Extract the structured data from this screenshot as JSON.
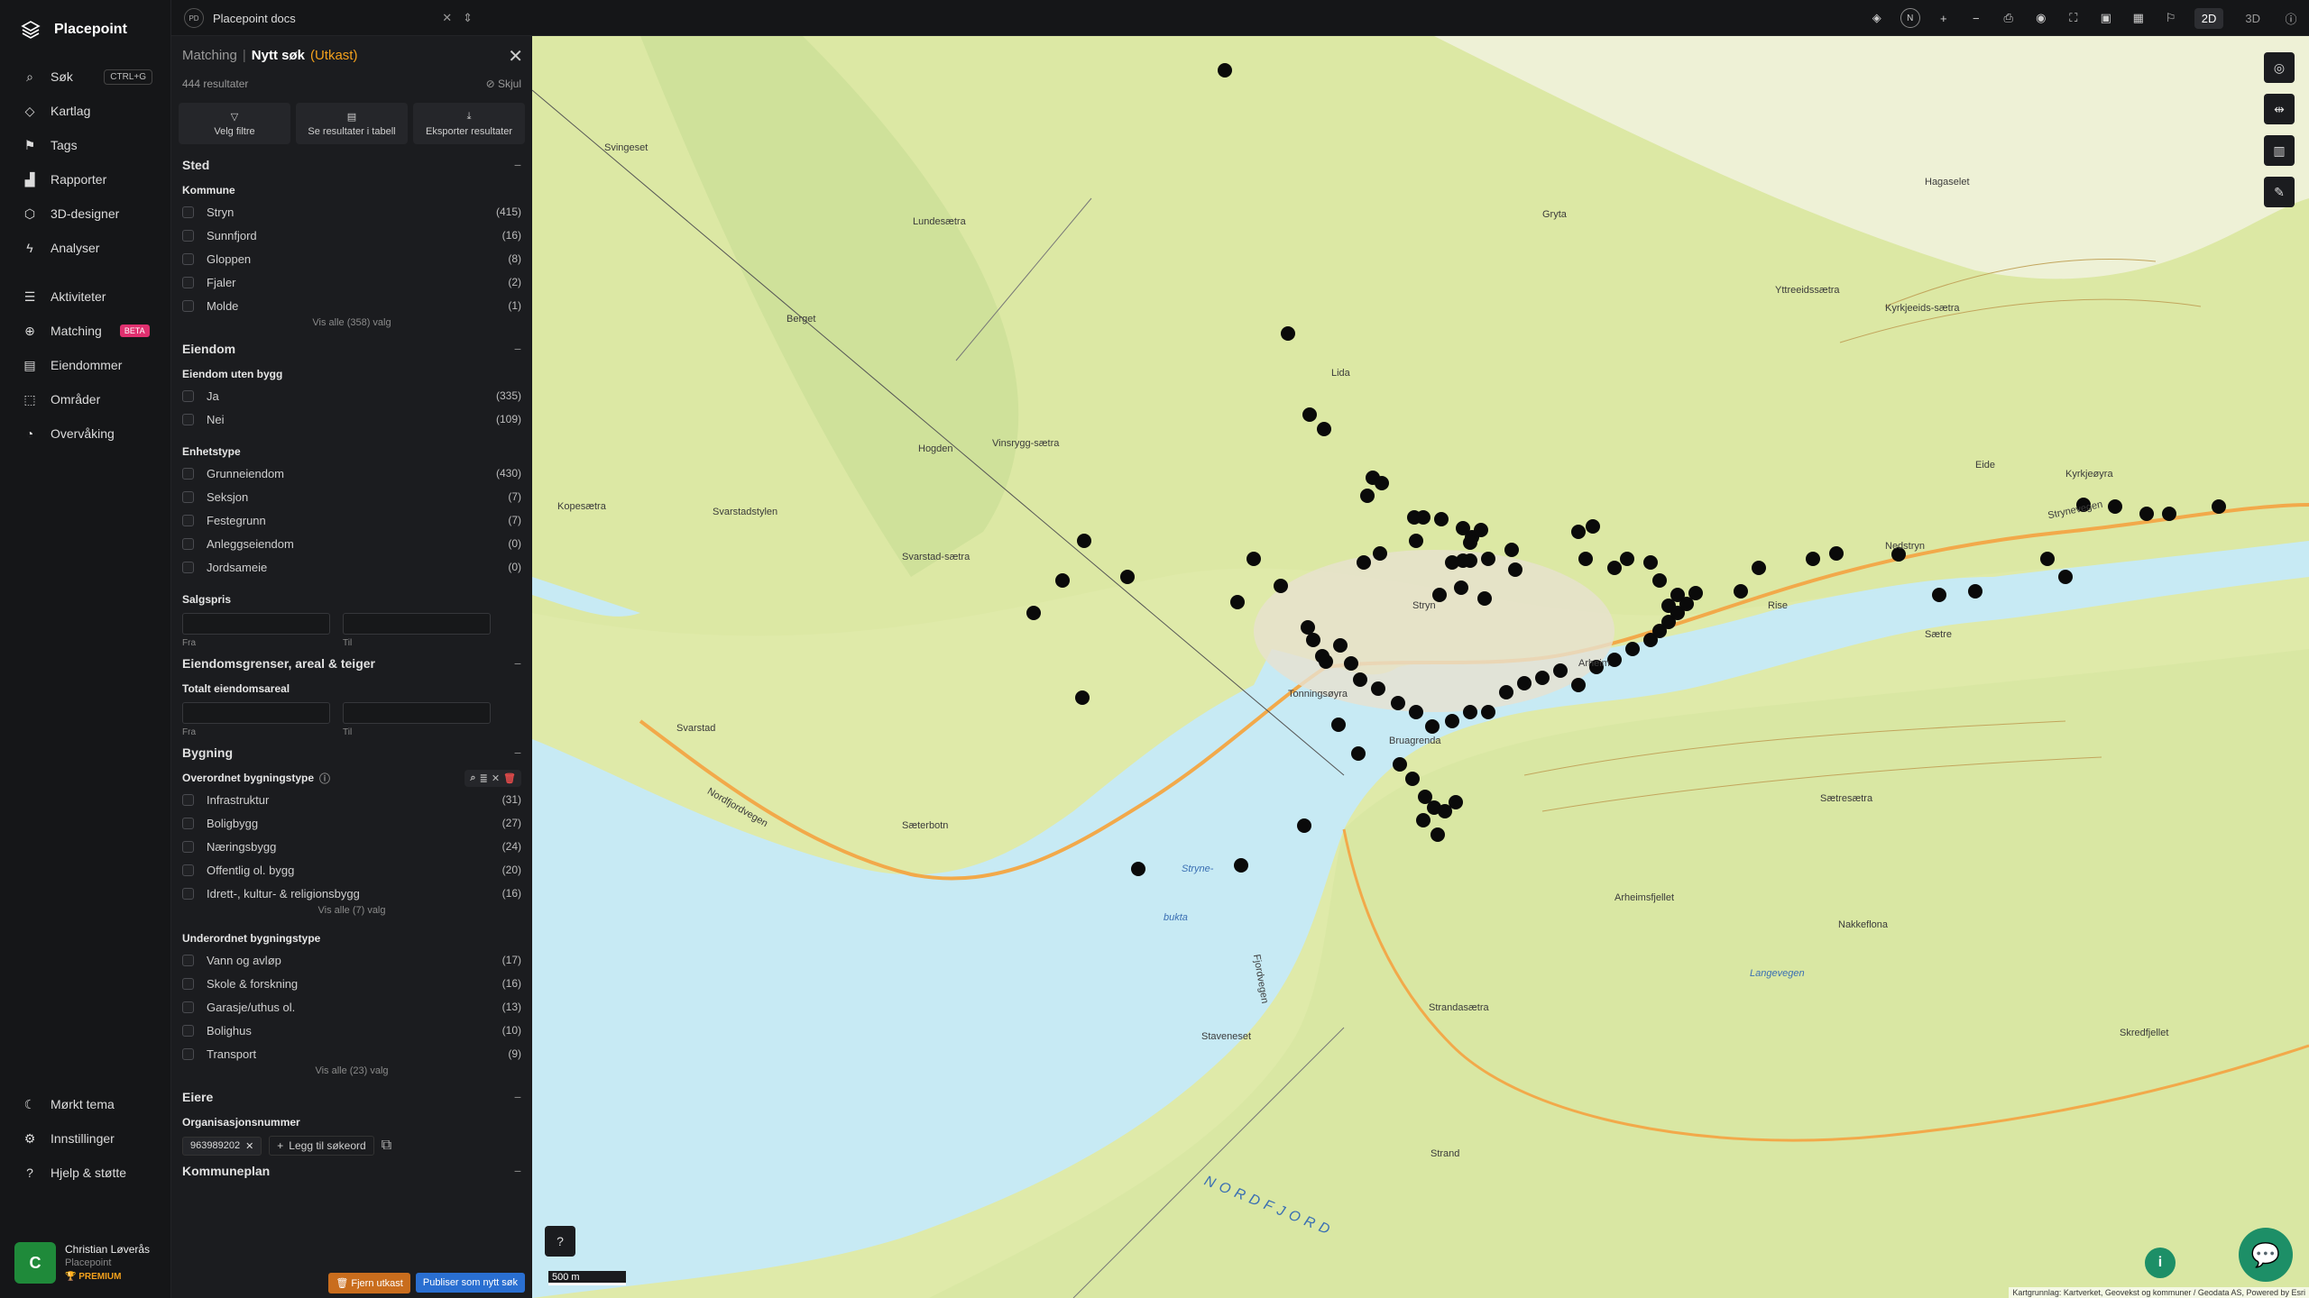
{
  "app": {
    "name": "Placepoint"
  },
  "nav": {
    "items": [
      {
        "label": "Søk",
        "kbd": "CTRL+G",
        "icon": "search-icon"
      },
      {
        "label": "Kartlag",
        "icon": "layers-icon"
      },
      {
        "label": "Tags",
        "icon": "bookmark-icon"
      },
      {
        "label": "Rapporter",
        "icon": "chart-icon"
      },
      {
        "label": "3D-designer",
        "icon": "cube-icon"
      },
      {
        "label": "Analyser",
        "icon": "bolt-icon"
      }
    ],
    "items2": [
      {
        "label": "Aktiviteter",
        "icon": "activity-icon"
      },
      {
        "label": "Matching",
        "badge": "BETA",
        "icon": "match-icon"
      },
      {
        "label": "Eiendommer",
        "icon": "building-icon"
      },
      {
        "label": "Områder",
        "icon": "area-icon"
      },
      {
        "label": "Overvåking",
        "icon": "monitor-icon"
      }
    ],
    "bottom": [
      {
        "label": "Mørkt tema",
        "icon": "moon-icon"
      },
      {
        "label": "Innstillinger",
        "icon": "gear-icon"
      },
      {
        "label": "Hjelp & støtte",
        "icon": "help-icon"
      }
    ],
    "user": {
      "initial": "C",
      "name": "Christian Løverås",
      "org": "Placepoint",
      "plan": "PREMIUM"
    }
  },
  "topbar": {
    "doc_badge": "PD",
    "doc_title": "Placepoint docs",
    "view_2d": "2D",
    "view_3d": "3D"
  },
  "panel": {
    "crumb": "Matching",
    "sep": "|",
    "title": "Nytt søk",
    "draft": "(Utkast)",
    "results": "444 resultater",
    "hide": "Skjul",
    "actions": [
      "Velg filtre",
      "Se resultater i tabell",
      "Eksporter resultater"
    ],
    "sted": {
      "title": "Sted",
      "group": "Kommune",
      "rows": [
        {
          "label": "Stryn",
          "count": "(415)"
        },
        {
          "label": "Sunnfjord",
          "count": "(16)"
        },
        {
          "label": "Gloppen",
          "count": "(8)"
        },
        {
          "label": "Fjaler",
          "count": "(2)"
        },
        {
          "label": "Molde",
          "count": "(1)"
        }
      ],
      "show_all": "Vis alle (358) valg"
    },
    "eiendom": {
      "title": "Eiendom",
      "group1": "Eiendom uten bygg",
      "rows1": [
        {
          "label": "Ja",
          "count": "(335)"
        },
        {
          "label": "Nei",
          "count": "(109)"
        }
      ],
      "group2": "Enhetstype",
      "rows2": [
        {
          "label": "Grunneiendom",
          "count": "(430)"
        },
        {
          "label": "Seksjon",
          "count": "(7)"
        },
        {
          "label": "Festegrunn",
          "count": "(7)"
        },
        {
          "label": "Anleggseiendom",
          "count": "(0)"
        },
        {
          "label": "Jordsameie",
          "count": "(0)"
        }
      ],
      "group3": "Salgspris",
      "from": "Fra",
      "to": "Til"
    },
    "areal": {
      "title": "Eiendomsgrenser, areal & teiger",
      "group": "Totalt eiendomsareal",
      "from": "Fra",
      "to": "Til"
    },
    "bygning": {
      "title": "Bygning",
      "group1": "Overordnet bygningstype",
      "rows1": [
        {
          "label": "Infrastruktur",
          "count": "(31)"
        },
        {
          "label": "Boligbygg",
          "count": "(27)"
        },
        {
          "label": "Næringsbygg",
          "count": "(24)"
        },
        {
          "label": "Offentlig ol. bygg",
          "count": "(20)"
        },
        {
          "label": "Idrett-, kultur- & religionsbygg",
          "count": "(16)"
        }
      ],
      "show_all1": "Vis alle (7) valg",
      "group2": "Underordnet bygningstype",
      "rows2": [
        {
          "label": "Vann og avløp",
          "count": "(17)"
        },
        {
          "label": "Skole & forskning",
          "count": "(16)"
        },
        {
          "label": "Garasje/uthus ol.",
          "count": "(13)"
        },
        {
          "label": "Bolighus",
          "count": "(10)"
        },
        {
          "label": "Transport",
          "count": "(9)"
        }
      ],
      "show_all2": "Vis alle (23) valg"
    },
    "eiere": {
      "title": "Eiere",
      "group": "Organisasjonsnummer",
      "chip": "963989202",
      "add": "Legg til søkeord"
    },
    "kommuneplan": {
      "title": "Kommuneplan"
    },
    "footer": {
      "remove": "Fjern utkast",
      "publish": "Publiser som nytt søk"
    }
  },
  "map": {
    "scale": "500 m",
    "attribution": "Kartgrunnlag: Kartverket, Geovekst og kommuner / Geodata AS, Powered by Esri",
    "labels": [
      "Svingeset",
      "Lundesætra",
      "Berget",
      "Vinsrygg-sætra",
      "Svarstadstylen",
      "Kopesætra",
      "Hogden",
      "Svarstad",
      "Svarstad-sætra",
      "Nordfjordvegen",
      "Sæterbotn",
      "Stryne-",
      "bukta",
      "Fjordvegen",
      "Staveneset",
      "NORDFJORD",
      "Strand",
      "Strandasætra",
      "Arheimsfjellet",
      "Nakkeflona",
      "Sætresætra",
      "Bruagrenda",
      "Stryn",
      "Tonningsøyra",
      "Sætre",
      "Nedstryn",
      "Strynevegen",
      "Kyrkjeøyra",
      "Gryta",
      "Hagaselet",
      "Yttreeidssætra",
      "Kyrkjeeids-sætra",
      "Langevegen",
      "Skredfjellet",
      "Rise",
      "Lida",
      "Arheim",
      "Eide"
    ]
  }
}
